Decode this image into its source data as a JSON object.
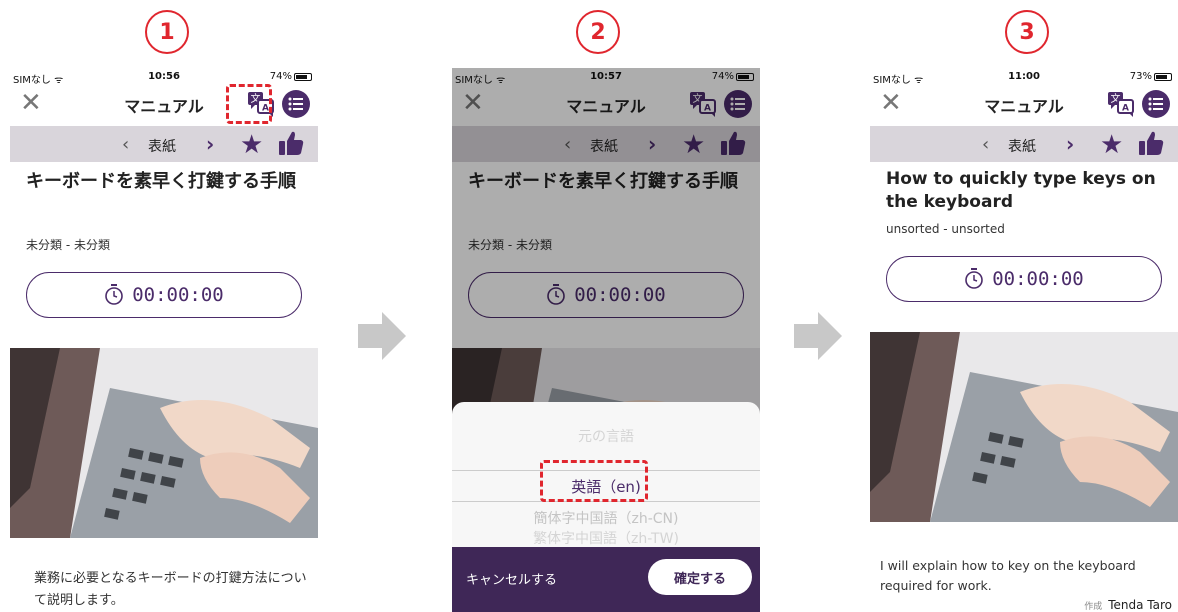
{
  "steps": [
    "1",
    "2",
    "3"
  ],
  "colors": {
    "accent": "#4b2c6a",
    "highlight": "#e0262e",
    "arrow": "#c8c8c8"
  },
  "screens": [
    {
      "status": {
        "carrier": "SIMなし",
        "time": "10:56",
        "battery": "74%"
      },
      "nav_title": "マニュアル",
      "page": "表紙",
      "title": "キーボードを素早く打鍵する手順",
      "category": "未分類 - 未分類",
      "timer": "00:00:00",
      "description": "業務に必要となるキーボードの打鍵方法について説明します。"
    },
    {
      "status": {
        "carrier": "SIMなし",
        "time": "10:57",
        "battery": "74%"
      },
      "nav_title": "マニュアル",
      "page": "表紙",
      "title": "キーボードを素早く打鍵する手順",
      "category": "未分類 - 未分類",
      "timer": "00:00:00",
      "picker": {
        "options_above": [
          "元の言語",
          ""
        ],
        "selected": "英語（en)",
        "options_below": [
          "簡体字中国語（zh-CN)",
          "繁体字中国語（zh-TW)"
        ]
      },
      "cancel_label": "キャンセルする",
      "confirm_label": "確定する"
    },
    {
      "status": {
        "carrier": "SIMなし",
        "time": "11:00",
        "battery": "73%"
      },
      "nav_title": "マニュアル",
      "page": "表紙",
      "title": "How to quickly type keys on the keyboard",
      "category": "unsorted - unsorted",
      "timer": "00:00:00",
      "description": "I will explain how to key on the keyboard required for work.",
      "author_label": "作成",
      "author": "Tenda Taro"
    }
  ]
}
